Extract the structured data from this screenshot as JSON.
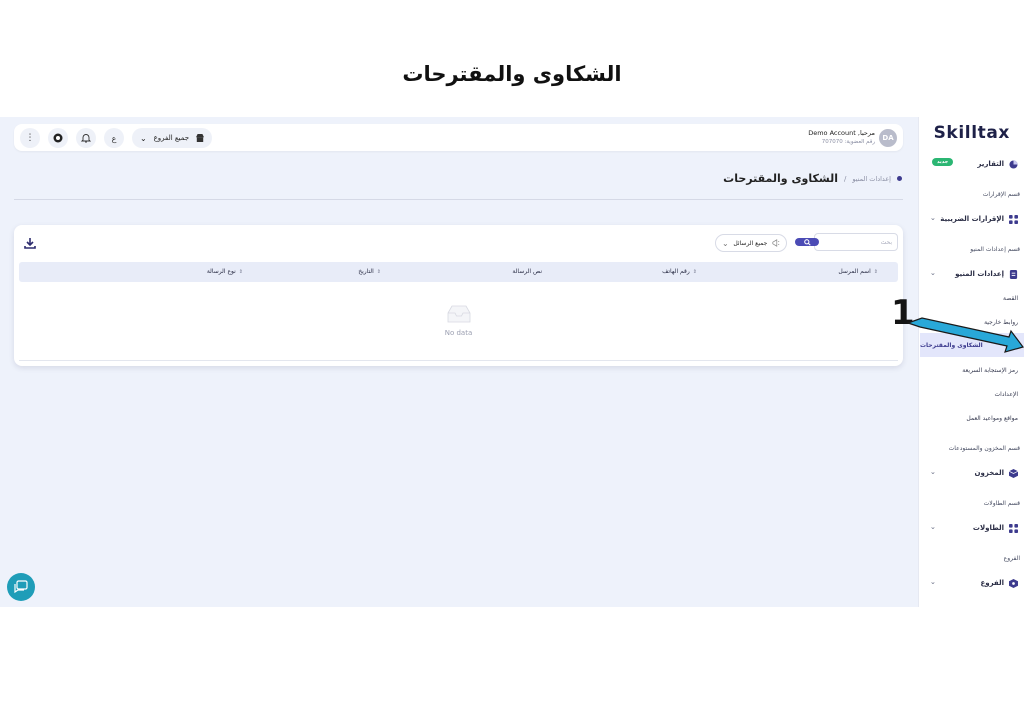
{
  "doc_title": "الشكاوى والمقترحات",
  "sidebar": {
    "logo": "Skilltax",
    "reports": {
      "label": "التقارير",
      "badge": "جديد"
    },
    "sections": [
      {
        "label": "قسم الإقرارات"
      },
      {
        "label": "قسم إعدادات المنيو"
      },
      {
        "label": "قسم المخزون والمستودعات"
      },
      {
        "label": "قسم الطاولات"
      },
      {
        "label": "الفروع"
      }
    ],
    "tax_returns": "الإقرارات الضريبية",
    "menu_settings": "إعدادات المنيو",
    "menu_sub": [
      "القصة",
      "روابط خارجية",
      "الشكاوى والمقترحات",
      "رمز الإستجابة السريعة",
      "الإعدادات",
      "مواقع ومواعيد العمل"
    ],
    "inventory": "المخزون",
    "tables": "الطاولات",
    "branches": "الفروع"
  },
  "topbar": {
    "branch_select": "جميع الفروع",
    "user_name": "مرحبا, Demo Account",
    "user_sub": "رقم العضوية: 707070",
    "avatar": "DA"
  },
  "breadcrumb": {
    "parent": "إعدادات المنيو",
    "separator": "/",
    "current": "الشكاوى والمقترحات"
  },
  "table": {
    "search_placeholder": "بحث",
    "message_filter": "جميع الرسائل",
    "columns": [
      "اسم المرسل",
      "رقم الهاتف",
      "نص الرسالة",
      "التاريخ",
      "نوع الرسالة"
    ],
    "empty_text": "No data"
  },
  "annotation": {
    "number": "1",
    "color": "#29a8d8"
  },
  "colors": {
    "accent": "#4b4bb5",
    "active_bg": "#e3e6fb",
    "badge": "#2bb673",
    "fab": "#1f9db8"
  }
}
